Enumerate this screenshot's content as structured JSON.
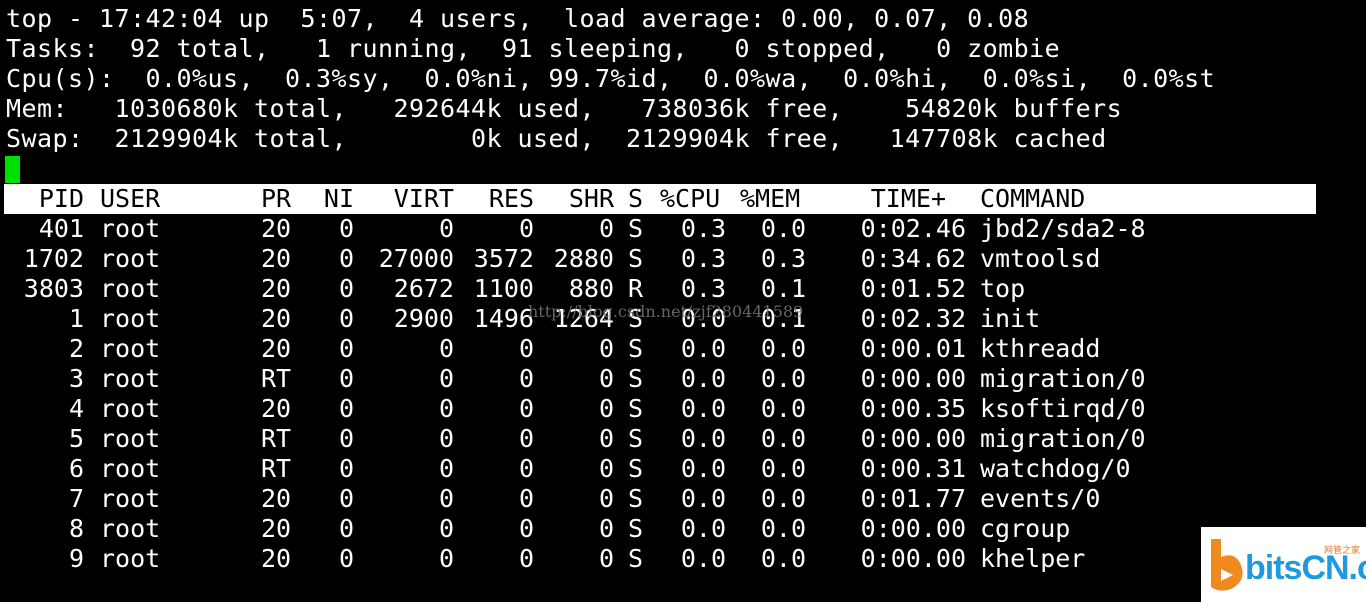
{
  "summary": {
    "line1": "top - 17:42:04 up  5:07,  4 users,  load average: 0.00, 0.07, 0.08",
    "line2": "Tasks:  92 total,   1 running,  91 sleeping,   0 stopped,   0 zombie",
    "line3": "Cpu(s):  0.0%us,  0.3%sy,  0.0%ni, 99.7%id,  0.0%wa,  0.0%hi,  0.0%si,  0.0%st",
    "line4": "Mem:   1030680k total,   292644k used,   738036k free,    54820k buffers",
    "line5": "Swap:  2129904k total,        0k used,  2129904k free,   147708k cached"
  },
  "columns": [
    "PID",
    "USER",
    "PR",
    "NI",
    "VIRT",
    "RES",
    "SHR",
    "S",
    "%CPU",
    "%MEM",
    "TIME+",
    "COMMAND"
  ],
  "processes": [
    [
      "401",
      "root",
      "20",
      "0",
      "0",
      "0",
      "0",
      "S",
      "0.3",
      "0.0",
      "0:02.46",
      "jbd2/sda2-8"
    ],
    [
      "1702",
      "root",
      "20",
      "0",
      "27000",
      "3572",
      "2880",
      "S",
      "0.3",
      "0.3",
      "0:34.62",
      "vmtoolsd"
    ],
    [
      "3803",
      "root",
      "20",
      "0",
      "2672",
      "1100",
      "880",
      "R",
      "0.3",
      "0.1",
      "0:01.52",
      "top"
    ],
    [
      "1",
      "root",
      "20",
      "0",
      "2900",
      "1496",
      "1264",
      "S",
      "0.0",
      "0.1",
      "0:02.32",
      "init"
    ],
    [
      "2",
      "root",
      "20",
      "0",
      "0",
      "0",
      "0",
      "S",
      "0.0",
      "0.0",
      "0:00.01",
      "kthreadd"
    ],
    [
      "3",
      "root",
      "RT",
      "0",
      "0",
      "0",
      "0",
      "S",
      "0.0",
      "0.0",
      "0:00.00",
      "migration/0"
    ],
    [
      "4",
      "root",
      "20",
      "0",
      "0",
      "0",
      "0",
      "S",
      "0.0",
      "0.0",
      "0:00.35",
      "ksoftirqd/0"
    ],
    [
      "5",
      "root",
      "RT",
      "0",
      "0",
      "0",
      "0",
      "S",
      "0.0",
      "0.0",
      "0:00.00",
      "migration/0"
    ],
    [
      "6",
      "root",
      "RT",
      "0",
      "0",
      "0",
      "0",
      "S",
      "0.0",
      "0.0",
      "0:00.31",
      "watchdog/0"
    ],
    [
      "7",
      "root",
      "20",
      "0",
      "0",
      "0",
      "0",
      "S",
      "0.0",
      "0.0",
      "0:01.77",
      "events/0"
    ],
    [
      "8",
      "root",
      "20",
      "0",
      "0",
      "0",
      "0",
      "S",
      "0.0",
      "0.0",
      "0:00.00",
      "cgroup"
    ],
    [
      "9",
      "root",
      "20",
      "0",
      "0",
      "0",
      "0",
      "S",
      "0.0",
      "0.0",
      "0:00.00",
      "khelper"
    ]
  ],
  "watermark": "http://blog.csdn.net/zjf280441589",
  "logo": {
    "text": "bitsCN.com",
    "sub": "网管之家"
  }
}
